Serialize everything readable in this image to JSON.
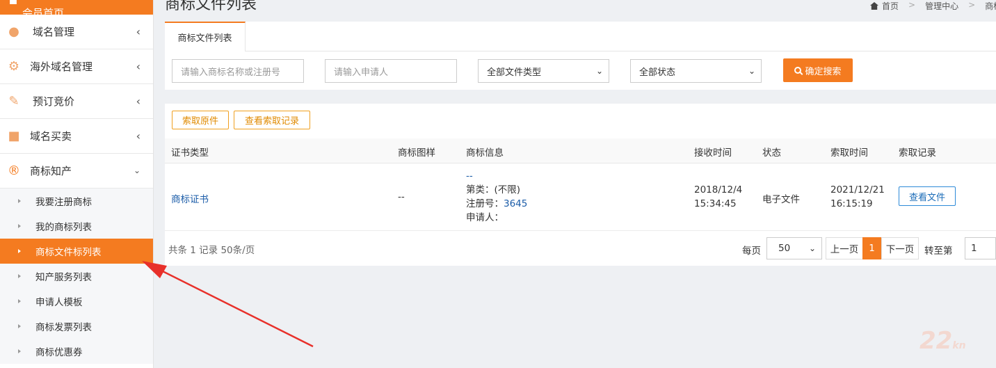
{
  "sidebar": {
    "top_label": "会员首页",
    "items": [
      {
        "label": "域名管理",
        "icon": "globe-icon"
      },
      {
        "label": "海外域名管理",
        "icon": "gear-icon"
      },
      {
        "label": "预订竞价",
        "icon": "gavel-icon"
      },
      {
        "label": "域名买卖",
        "icon": "briefcase-icon"
      },
      {
        "label": "商标知产",
        "icon": "registered-icon"
      }
    ],
    "submenu": [
      {
        "label": "我要注册商标"
      },
      {
        "label": "我的商标列表"
      },
      {
        "label": "商标文件标列表",
        "active": true
      },
      {
        "label": "知产服务列表"
      },
      {
        "label": "申请人模板"
      },
      {
        "label": "商标发票列表"
      },
      {
        "label": "商标优惠券"
      }
    ]
  },
  "header": {
    "title": "商标文件列表",
    "breadcrumb": [
      "首页",
      "管理中心",
      "商标"
    ]
  },
  "search": {
    "tab": "商标文件列表",
    "name_placeholder": "请输入商标名称或注册号",
    "applicant_placeholder": "请输入申请人",
    "type_select": "全部文件类型",
    "status_select": "全部状态",
    "search_button": "确定搜索"
  },
  "actions": {
    "request_original": "索取原件",
    "view_records": "查看索取记录"
  },
  "table": {
    "columns": [
      "证书类型",
      "商标图样",
      "商标信息",
      "接收时间",
      "状态",
      "索取时间",
      "索取记录"
    ],
    "rows": [
      {
        "type": "商标证书",
        "image": "--",
        "info_name": "--",
        "info_class": "第类：(不限)",
        "info_reg_label": "注册号：",
        "info_reg_no": "3645",
        "info_applicant": "申请人：",
        "received_date": "2018/12/4",
        "received_time": "15:34:45",
        "status": "电子文件",
        "request_date": "2021/12/21",
        "request_time": "16:15:19",
        "view_button": "查看文件"
      }
    ]
  },
  "footer": {
    "summary": "共条 1 记录 50条/页",
    "per_page_label": "每页",
    "per_page_value": "50",
    "prev": "上一页",
    "current_page": "1",
    "next": "下一页",
    "goto_label": "转至第",
    "goto_value": "1"
  },
  "watermark": {
    "main": "22",
    "suffix": "kn"
  },
  "colors": {
    "accent": "#f47b20",
    "link": "#1b5ca8",
    "arrow": "#e8302a"
  }
}
